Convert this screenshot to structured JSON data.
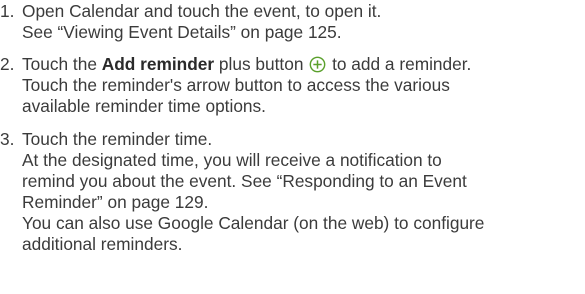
{
  "steps": [
    {
      "number": "1.",
      "first_line": "Open Calendar and touch the event, to open it.",
      "lines": [
        "See “Viewing Event Details” on page 125."
      ]
    },
    {
      "number": "2.",
      "prefix": "Touch the ",
      "bold": "Add reminder",
      "middle": " plus button ",
      "icon": "plus-circle-icon",
      "icon_color": "#5aa02c",
      "suffix": " to add a reminder.",
      "lines": [
        "Touch the reminder's arrow button to access the various",
        "available reminder time options."
      ]
    },
    {
      "number": "3.",
      "first_line": "Touch the reminder time.",
      "lines": [
        "At the designated time, you will receive a notification to",
        "remind you about the event. See “Responding to an Event",
        "Reminder” on page 129.",
        "You can also use Google Calendar (on the web) to configure",
        "additional reminders."
      ]
    }
  ]
}
